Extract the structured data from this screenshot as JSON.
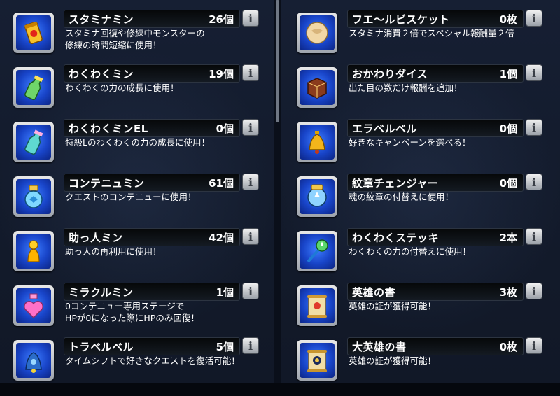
{
  "left_items": [
    {
      "icon": "stamina-can-icon",
      "name": "スタミナミン",
      "count": "26個",
      "desc": [
        "スタミナ回復や修練中モンスターの",
        "修練の時間短縮に使用！"
      ]
    },
    {
      "icon": "green-bottle-icon",
      "name": "わくわくミン",
      "count": "19個",
      "desc": [
        "わくわくの力の成長に使用！"
      ]
    },
    {
      "icon": "teal-bottle-icon",
      "name": "わくわくミンEL",
      "count": "0個",
      "desc": [
        "特級Lのわくわくの力の成長に使用！"
      ]
    },
    {
      "icon": "blue-flask-icon",
      "name": "コンテニュミン",
      "count": "61個",
      "desc": [
        "クエストのコンテニューに使用！"
      ]
    },
    {
      "icon": "helper-figure-icon",
      "name": "助っ人ミン",
      "count": "42個",
      "desc": [
        "助っ人の再利用に使用！"
      ]
    },
    {
      "icon": "heart-potion-icon",
      "name": "ミラクルミン",
      "count": "1個",
      "desc": [
        "0コンテニュー専用ステージで",
        "HPが0になった際にHPのみ回復！"
      ]
    },
    {
      "icon": "blue-bell-icon",
      "name": "トラベルベル",
      "count": "5個",
      "desc": [
        "タイムシフトで好きなクエストを復活可能！"
      ]
    }
  ],
  "right_items": [
    {
      "icon": "biscuit-icon",
      "name": "フエ〜ルビスケット",
      "count": "0枚",
      "desc": [
        "スタミナ消費２倍でスペシャル報酬量２倍"
      ]
    },
    {
      "icon": "dice-icon",
      "name": "おかわりダイス",
      "count": "1個",
      "desc": [
        "出た目の数だけ報酬を追加！"
      ]
    },
    {
      "icon": "gold-bell-icon",
      "name": "エラベルベル",
      "count": "0個",
      "desc": [
        "好きなキャンペーンを選べる！"
      ]
    },
    {
      "icon": "emblem-changer-icon",
      "name": "紋章チェンジャー",
      "count": "0個",
      "desc": [
        "魂の紋章の付替えに使用！"
      ]
    },
    {
      "icon": "magic-wand-icon",
      "name": "わくわくステッキ",
      "count": "2本",
      "desc": [
        "わくわくの力の付替えに使用！"
      ]
    },
    {
      "icon": "scroll-icon",
      "name": "英雄の書",
      "count": "3枚",
      "desc": [
        "英雄の証が獲得可能！"
      ]
    },
    {
      "icon": "great-scroll-icon",
      "name": "大英雄の書",
      "count": "0枚",
      "desc": [
        "英雄の証が獲得可能！"
      ]
    }
  ],
  "info_label": "i"
}
